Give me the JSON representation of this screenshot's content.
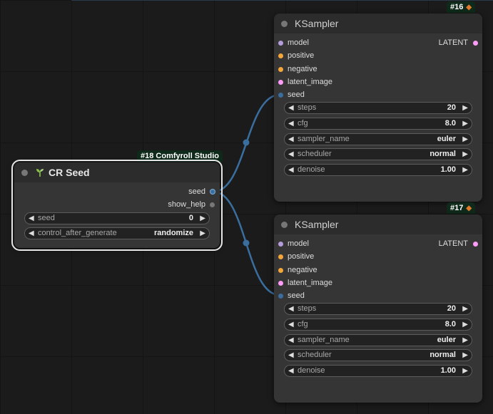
{
  "colors": {
    "link": "#3a6e9e",
    "model_slot": "#b39ddb",
    "positive_slot": "#f3a63a",
    "negative_slot": "#f3a63a",
    "latent_slot": "#ff9cf9",
    "seed_slot": "#3a6e9e",
    "badge_bg": "#0f2a1a"
  },
  "cr_seed": {
    "badge": "#18 Comfyroll Studio",
    "title": "CR Seed",
    "outputs": {
      "seed": "seed",
      "show_help": "show_help"
    },
    "widgets": [
      {
        "label": "seed",
        "value": "0"
      },
      {
        "label": "control_after_generate",
        "value": "randomize"
      }
    ]
  },
  "ksamplers": [
    {
      "badge": "#16",
      "title": "KSampler",
      "inputs": [
        "model",
        "positive",
        "negative",
        "latent_image",
        "seed"
      ],
      "output": "LATENT",
      "widgets": [
        {
          "label": "steps",
          "value": "20"
        },
        {
          "label": "cfg",
          "value": "8.0"
        },
        {
          "label": "sampler_name",
          "value": "euler"
        },
        {
          "label": "scheduler",
          "value": "normal"
        },
        {
          "label": "denoise",
          "value": "1.00"
        }
      ]
    },
    {
      "badge": "#17",
      "title": "KSampler",
      "inputs": [
        "model",
        "positive",
        "negative",
        "latent_image",
        "seed"
      ],
      "output": "LATENT",
      "widgets": [
        {
          "label": "steps",
          "value": "20"
        },
        {
          "label": "cfg",
          "value": "8.0"
        },
        {
          "label": "sampler_name",
          "value": "euler"
        },
        {
          "label": "scheduler",
          "value": "normal"
        },
        {
          "label": "denoise",
          "value": "1.00"
        }
      ]
    }
  ]
}
